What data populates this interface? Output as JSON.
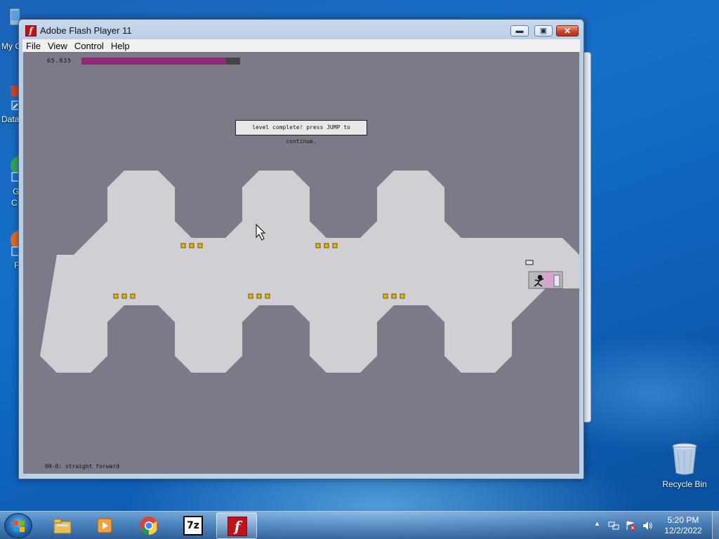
{
  "desktop": {
    "icons": [
      {
        "label": "My C",
        "icon": "computer-icon"
      },
      {
        "label": "Data",
        "icon": "shortcut-icon"
      },
      {
        "label": "G",
        "label2": "C",
        "icon": "chrome-shortcut-icon"
      },
      {
        "label": "F",
        "icon": "firefox-shortcut-icon"
      },
      {
        "label": "Recycle Bin",
        "icon": "recycle-bin-icon"
      }
    ]
  },
  "window": {
    "title": "Adobe Flash Player 11",
    "icon": "flash-icon",
    "controls": {
      "minimize": "minimize-icon",
      "maximize": "maximize-icon",
      "close": "close-icon"
    },
    "menu": [
      "File",
      "View",
      "Control",
      "Help"
    ]
  },
  "game": {
    "timer_value": "65.835",
    "time_remaining_fraction": 0.91,
    "message": "level complete! press JUMP to continue.",
    "level_name": "00-0: straight forward",
    "colors": {
      "background": "#7b7a88",
      "floor": "#d0d0d4",
      "timer_bar": "#8e2a79",
      "gold": "#e2b90c",
      "exit_door": "#d6a6cf"
    }
  },
  "taskbar": {
    "start": "windows-start-icon",
    "apps": [
      {
        "name": "file-explorer-icon"
      },
      {
        "name": "media-player-icon"
      },
      {
        "name": "chrome-icon"
      },
      {
        "name": "7zip-icon",
        "text": "7z"
      },
      {
        "name": "flash-player-icon",
        "active": true
      }
    ],
    "tray": {
      "icons": [
        "show-hidden-icons-icon",
        "network-icon",
        "action-center-icon",
        "volume-icon"
      ]
    },
    "clock": {
      "time": "5:20 PM",
      "date": "12/2/2022"
    }
  }
}
